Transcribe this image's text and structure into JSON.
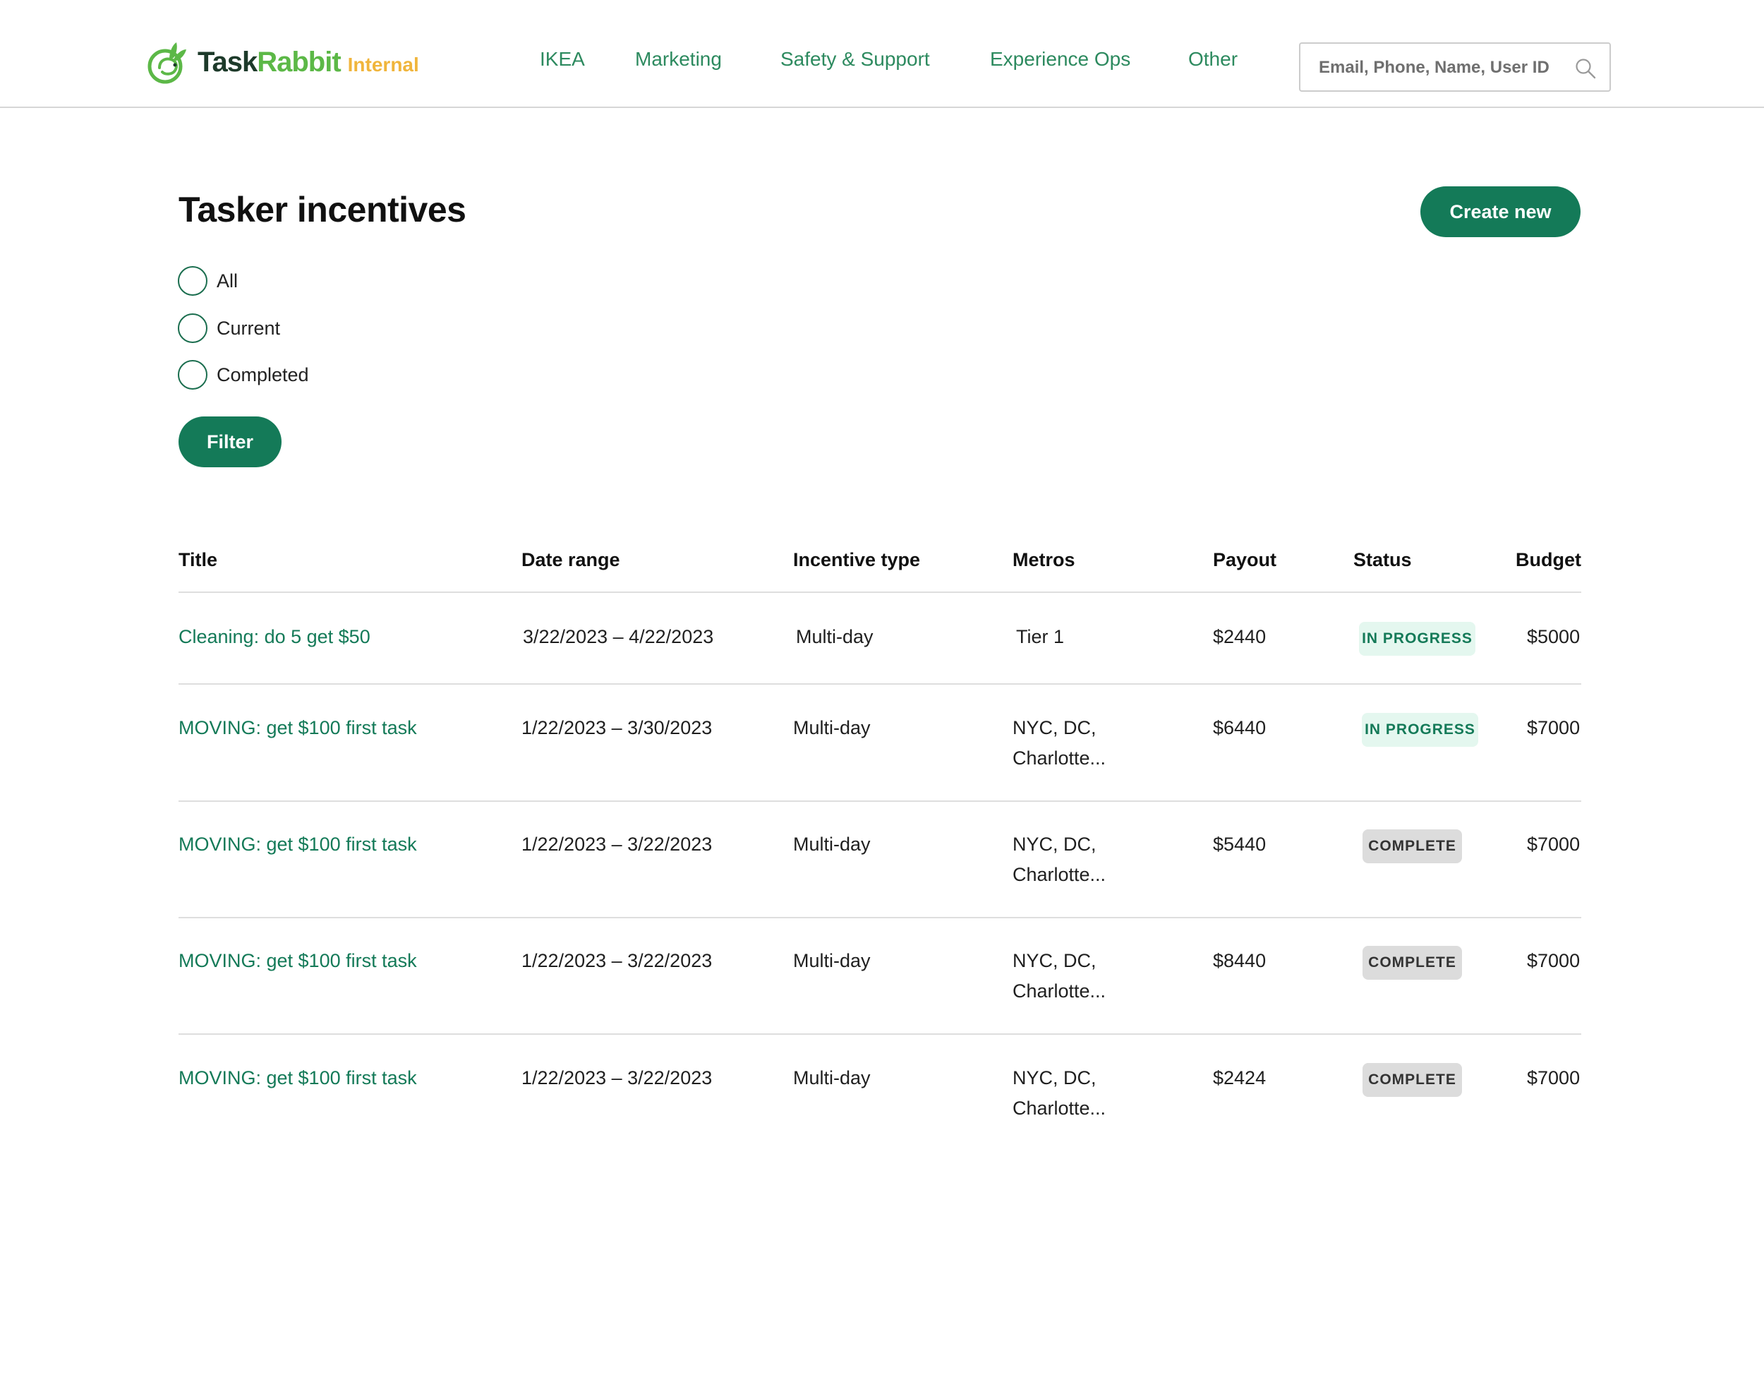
{
  "header": {
    "logo": {
      "task": "Task",
      "rabbit": "Rabbit",
      "internal": "Internal"
    },
    "nav": [
      "IKEA",
      "Marketing",
      "Safety & Support",
      "Experience Ops",
      "Other"
    ],
    "search": {
      "placeholder": "Email, Phone, Name, User ID"
    }
  },
  "main": {
    "title": "Tasker incentives",
    "create_button": "Create new",
    "filters": [
      "All",
      "Current",
      "Completed"
    ],
    "filter_button": "Filter"
  },
  "table": {
    "columns": [
      "Title",
      "Date range",
      "Incentive type",
      "Metros",
      "Payout",
      "Status",
      "Budget"
    ],
    "rows": [
      {
        "title": "Cleaning: do 5 get $50",
        "date_range": "3/22/2023 – 4/22/2023",
        "type": "Multi-day",
        "metros": [
          "Tier 1"
        ],
        "payout": "$2440",
        "status": "IN PROGRESS",
        "budget": "$5000"
      },
      {
        "title": "MOVING: get $100 first task",
        "date_range": "1/22/2023 – 3/30/2023",
        "type": "Multi-day",
        "metros": [
          "NYC, DC,",
          "Charlotte..."
        ],
        "payout": "$6440",
        "status": "IN PROGRESS",
        "budget": "$7000"
      },
      {
        "title": "MOVING: get $100 first task",
        "date_range": "1/22/2023 – 3/22/2023",
        "type": "Multi-day",
        "metros": [
          "NYC, DC,",
          "Charlotte..."
        ],
        "payout": "$5440",
        "status": "COMPLETE",
        "budget": "$7000"
      },
      {
        "title": "MOVING: get $100 first task",
        "date_range": "1/22/2023 – 3/22/2023",
        "type": "Multi-day",
        "metros": [
          "NYC, DC,",
          "Charlotte..."
        ],
        "payout": "$8440",
        "status": "COMPLETE",
        "budget": "$7000"
      },
      {
        "title": "MOVING: get $100 first task",
        "date_range": "1/22/2023 – 3/22/2023",
        "type": "Multi-day",
        "metros": [
          "NYC, DC,",
          "Charlotte..."
        ],
        "payout": "$2424",
        "status": "COMPLETE",
        "budget": "$7000"
      }
    ]
  },
  "colors": {
    "brand_green": "#147a58",
    "nav_green": "#2d8a5f",
    "logo_dark": "#1d3a2a",
    "logo_green": "#5cb847",
    "logo_yellow": "#f0b53c",
    "badge_progress_bg": "#e4f7ef",
    "badge_complete_bg": "#dcdcdc"
  },
  "icons": {
    "logo": "rabbit-logo-icon",
    "search": "search-icon",
    "radio": "radio-icon"
  }
}
